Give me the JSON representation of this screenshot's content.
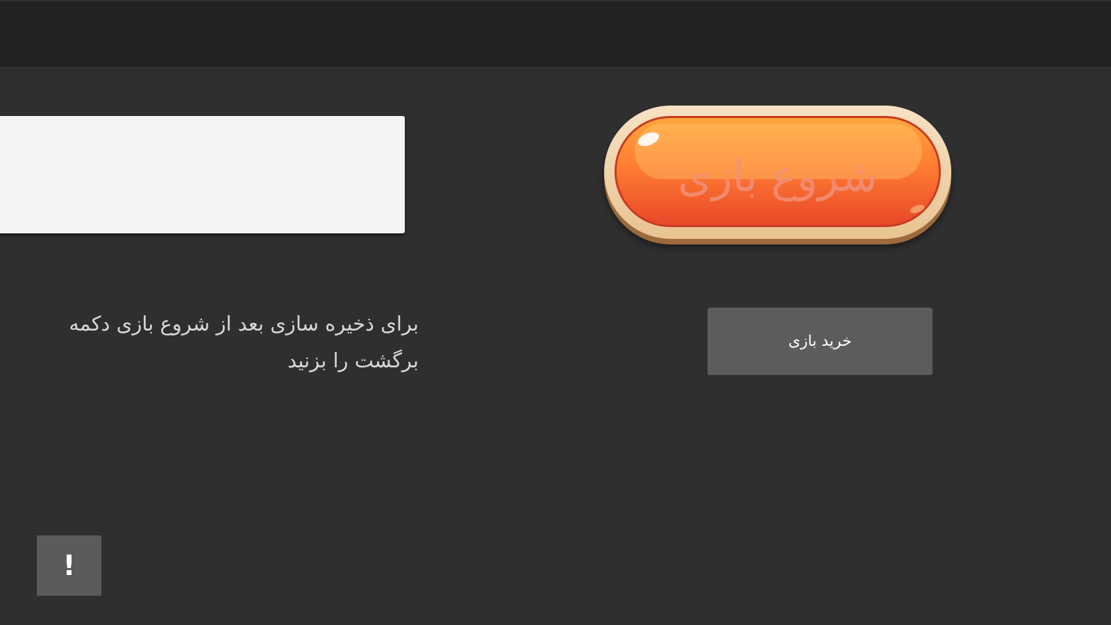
{
  "main": {
    "start_button_label": "شروع بازی",
    "buy_button_label": "خرید بازی",
    "hint_text": "برای ذخیره سازی بعد از شروع بازی دکمه برگشت را بزنید",
    "alert_button_label": "!"
  },
  "colors": {
    "background": "#2f2f2f",
    "top_bar": "#222222",
    "text_panel": "#f4f4f4",
    "start_button_orange": "#ff7d32",
    "start_button_rim": "#f7e2c4",
    "buy_button": "#5c5c5e",
    "alert_button": "#5b5b5d"
  },
  "icons": {
    "alert": "exclamation-icon"
  }
}
